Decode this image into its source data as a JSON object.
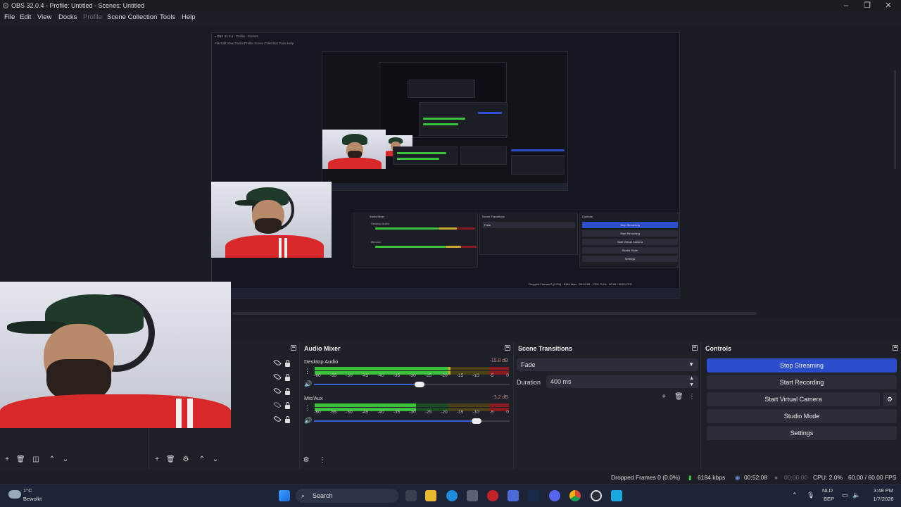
{
  "window": {
    "title": "OBS 32.0.4 - Profile: Untitled - Scenes: Untitled",
    "controls": [
      "minimize",
      "maximize",
      "close"
    ]
  },
  "menu": {
    "items": [
      {
        "label": "File",
        "enabled": true
      },
      {
        "label": "Edit",
        "enabled": true
      },
      {
        "label": "View",
        "enabled": true
      },
      {
        "label": "Docks",
        "enabled": true
      },
      {
        "label": "Profile",
        "enabled": false
      },
      {
        "label": "Scene Collection",
        "enabled": true
      },
      {
        "label": "Tools",
        "enabled": true
      },
      {
        "label": "Help",
        "enabled": true
      }
    ]
  },
  "audio_mixer": {
    "title": "Audio Mixer",
    "ticks": [
      "-60",
      "-55",
      "-50",
      "-45",
      "-40",
      "-35",
      "-30",
      "-25",
      "-20",
      "-15",
      "-10",
      "-5",
      "0"
    ],
    "tracks": [
      {
        "name": "Desktop Audio",
        "db": "-15.8 dB",
        "level": 0.7,
        "volume": 0.54
      },
      {
        "name": "Mic/Aux",
        "db": "-3.2 dB",
        "level": 0.52,
        "volume": 0.83
      }
    ]
  },
  "scene_transitions": {
    "title": "Scene Transitions",
    "transition": "Fade",
    "duration_label": "Duration",
    "duration": "400 ms"
  },
  "controls": {
    "title": "Controls",
    "buttons": [
      "Stop Streaming",
      "Start Recording",
      "Start Virtual Camera",
      "Studio Mode",
      "Settings"
    ]
  },
  "status": {
    "dropped_frames": "Dropped Frames 0 (0.0%)",
    "bitrate": "6184 kbps",
    "stream_time": "00:52:08",
    "record_time": "00:00:00",
    "cpu": "CPU: 2.0%",
    "fps": "60.00 / 60.00 FPS"
  },
  "taskbar": {
    "weather_temp": "1°C",
    "weather_desc": "Bewolkt",
    "search": "Search",
    "lang": "NLD",
    "lang_sub": "BEP",
    "time": "3:48 PM",
    "date": "1/7/2026"
  },
  "colors": {
    "accent": "#2c4ecc",
    "meter_green": "#3ac23a",
    "meter_yellow": "#c8a830",
    "meter_red": "#8a1a22"
  }
}
